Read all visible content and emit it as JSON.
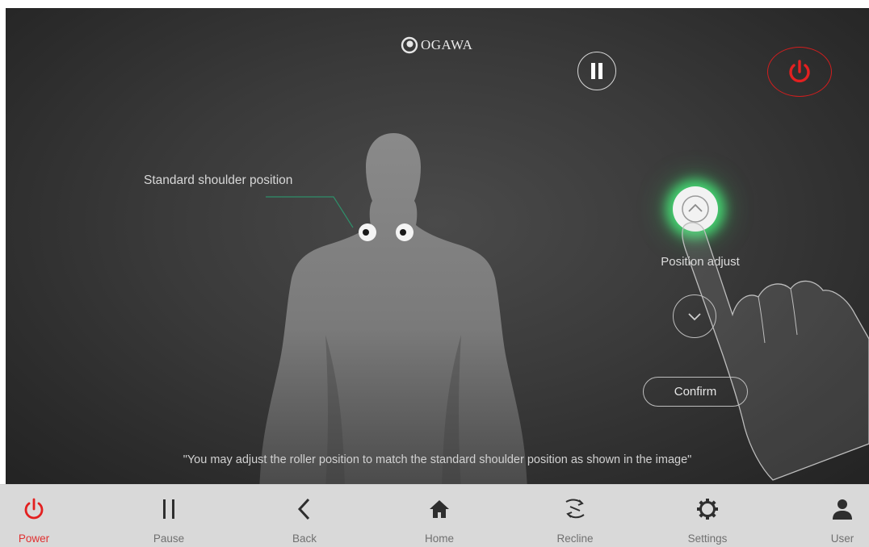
{
  "brand": {
    "name": "OGAWA"
  },
  "top_controls": {
    "pause_icon": "pause-icon",
    "power_icon": "power-icon",
    "power_color": "#e32020"
  },
  "body_map": {
    "label": "Standard shoulder position"
  },
  "position_panel": {
    "up_icon": "chevron-up-icon",
    "label": "Position adjust",
    "down_icon": "chevron-down-icon",
    "confirm_label": "Confirm",
    "highlight_color": "#3fe07a"
  },
  "hint_text": "\"You may adjust the roller position to match the standard shoulder position as shown in the image\"",
  "nav": {
    "items": [
      {
        "label": "Power",
        "icon": "power-icon"
      },
      {
        "label": "Pause",
        "icon": "pause-icon"
      },
      {
        "label": "Back",
        "icon": "back-icon"
      },
      {
        "label": "Home",
        "icon": "home-icon"
      },
      {
        "label": "Recline",
        "icon": "recline-icon"
      },
      {
        "label": "Settings",
        "icon": "gear-icon"
      },
      {
        "label": "User",
        "icon": "user-icon"
      }
    ]
  }
}
